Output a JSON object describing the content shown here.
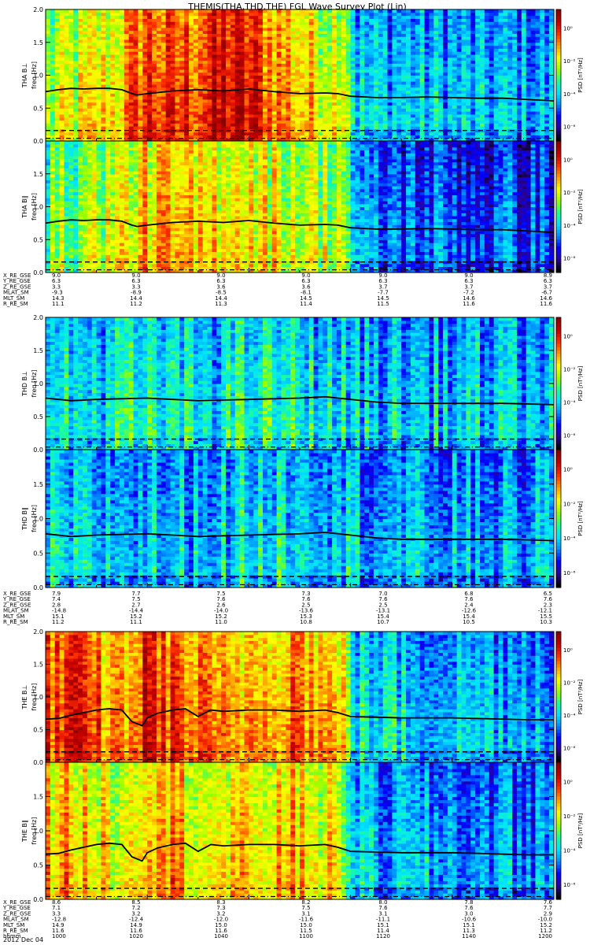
{
  "title": "THEMIS(THA,THD,THE) FGL Wave Survey Plot (Lin)",
  "date_label": "2012 Dec 04",
  "colors": {
    "colormap": [
      "#000000",
      "#2a00a0",
      "#0000ff",
      "#0090ff",
      "#00e5ff",
      "#20ff90",
      "#9aff00",
      "#ffff00",
      "#ffa000",
      "#ff3000",
      "#c80000",
      "#8a0000"
    ],
    "curve": "#000000"
  },
  "chart_data": [
    {
      "type": "heatmap",
      "ylabel": "THA B⊥",
      "yunit": "freq [Hz]",
      "ylim": [
        0,
        2.0
      ],
      "yticks": [
        "0.0",
        "0.5",
        "1.0",
        "1.5",
        "2.0"
      ],
      "colorbar": {
        "label": "PSD [nT²/Hz]",
        "ticks": [
          "10⁰",
          "10⁻²",
          "10⁻⁴",
          "10⁻⁶"
        ]
      },
      "xlim": [
        1000,
        1200
      ],
      "gyro_curve": {
        "x": [
          1000,
          1005,
          1010,
          1015,
          1020,
          1025,
          1030,
          1034,
          1036,
          1040,
          1045,
          1050,
          1060,
          1070,
          1080,
          1090,
          1100,
          1110,
          1115,
          1120,
          1130,
          1140,
          1150,
          1160,
          1170,
          1180,
          1190,
          1200
        ],
        "y": [
          0.75,
          0.78,
          0.8,
          0.79,
          0.8,
          0.8,
          0.78,
          0.72,
          0.7,
          0.72,
          0.74,
          0.76,
          0.78,
          0.76,
          0.79,
          0.75,
          0.72,
          0.73,
          0.72,
          0.68,
          0.66,
          0.66,
          0.67,
          0.66,
          0.65,
          0.65,
          0.63,
          0.61
        ]
      },
      "dashed_line_y": 0.16,
      "dashdot_line_y": 0.04,
      "activity": {
        "x": [
          1000,
          1010,
          1020,
          1030,
          1040,
          1050,
          1060,
          1070,
          1080,
          1090,
          1100,
          1110,
          1118,
          1122,
          1130,
          1140,
          1150,
          1160,
          1170,
          1180,
          1190,
          1200
        ],
        "level": [
          0.55,
          0.62,
          0.65,
          0.72,
          0.88,
          0.82,
          0.86,
          0.92,
          0.9,
          0.8,
          0.72,
          0.66,
          0.7,
          0.38,
          0.36,
          0.37,
          0.36,
          0.35,
          0.34,
          0.34,
          0.34,
          0.33
        ]
      }
    },
    {
      "type": "heatmap",
      "ylabel": "THA B∥",
      "yunit": "freq [Hz]",
      "ylim": [
        0,
        2.0
      ],
      "yticks": [
        "0.0",
        "0.5",
        "1.0",
        "1.5",
        "2.0"
      ],
      "colorbar": {
        "label": "PSD [nT²/Hz]",
        "ticks": [
          "10⁰",
          "10⁻²",
          "10⁻⁴",
          "10⁻⁶"
        ]
      },
      "xlim": [
        1000,
        1200
      ],
      "gyro_curve": {
        "x": [
          1000,
          1005,
          1010,
          1015,
          1020,
          1025,
          1030,
          1034,
          1036,
          1040,
          1045,
          1050,
          1060,
          1070,
          1080,
          1090,
          1100,
          1110,
          1115,
          1120,
          1130,
          1140,
          1150,
          1160,
          1170,
          1180,
          1190,
          1200
        ],
        "y": [
          0.75,
          0.78,
          0.8,
          0.79,
          0.8,
          0.8,
          0.78,
          0.72,
          0.7,
          0.72,
          0.74,
          0.76,
          0.78,
          0.76,
          0.79,
          0.75,
          0.72,
          0.73,
          0.72,
          0.68,
          0.66,
          0.66,
          0.67,
          0.66,
          0.65,
          0.65,
          0.63,
          0.61
        ]
      },
      "dashed_line_y": 0.16,
      "dashdot_line_y": 0.04,
      "activity": {
        "x": [
          1000,
          1010,
          1020,
          1030,
          1040,
          1050,
          1060,
          1070,
          1080,
          1090,
          1100,
          1110,
          1118,
          1122,
          1130,
          1140,
          1150,
          1160,
          1170,
          1180,
          1190,
          1200
        ],
        "level": [
          0.5,
          0.56,
          0.6,
          0.64,
          0.72,
          0.7,
          0.68,
          0.72,
          0.7,
          0.66,
          0.62,
          0.6,
          0.62,
          0.3,
          0.28,
          0.28,
          0.27,
          0.26,
          0.25,
          0.25,
          0.26,
          0.25
        ]
      }
    },
    {
      "type": "heatmap",
      "ylabel": "THD B⊥",
      "yunit": "freq [Hz]",
      "ylim": [
        0,
        2.0
      ],
      "yticks": [
        "0.0",
        "0.5",
        "1.0",
        "1.5",
        "2.0"
      ],
      "colorbar": {
        "label": "PSD [nT²/Hz]",
        "ticks": [
          "10⁰",
          "10⁻²",
          "10⁻⁴",
          "10⁻⁶"
        ]
      },
      "xlim": [
        1000,
        1200
      ],
      "gyro_curve": {
        "x": [
          1000,
          1010,
          1020,
          1030,
          1040,
          1050,
          1060,
          1070,
          1080,
          1090,
          1100,
          1110,
          1120,
          1130,
          1140,
          1150,
          1160,
          1170,
          1180,
          1190,
          1200
        ],
        "y": [
          0.78,
          0.74,
          0.76,
          0.77,
          0.78,
          0.76,
          0.74,
          0.75,
          0.76,
          0.77,
          0.78,
          0.8,
          0.76,
          0.72,
          0.7,
          0.7,
          0.7,
          0.7,
          0.7,
          0.69,
          0.68
        ]
      },
      "dashed_line_y": 0.16,
      "dashdot_line_y": 0.04,
      "activity": {
        "x": [
          1000,
          1010,
          1020,
          1030,
          1040,
          1050,
          1060,
          1070,
          1080,
          1090,
          1100,
          1110,
          1120,
          1130,
          1140,
          1150,
          1160,
          1170,
          1180,
          1190,
          1200
        ],
        "level": [
          0.42,
          0.4,
          0.4,
          0.44,
          0.42,
          0.4,
          0.4,
          0.42,
          0.44,
          0.44,
          0.42,
          0.4,
          0.38,
          0.36,
          0.36,
          0.36,
          0.36,
          0.36,
          0.35,
          0.35,
          0.35
        ]
      }
    },
    {
      "type": "heatmap",
      "ylabel": "THD B∥",
      "yunit": "freq [Hz]",
      "ylim": [
        0,
        2.0
      ],
      "yticks": [
        "0.0",
        "0.5",
        "1.0",
        "1.5",
        "2.0"
      ],
      "colorbar": {
        "label": "PSD [nT²/Hz]",
        "ticks": [
          "10⁰",
          "10⁻²",
          "10⁻⁴",
          "10⁻⁶"
        ]
      },
      "xlim": [
        1000,
        1200
      ],
      "gyro_curve": {
        "x": [
          1000,
          1010,
          1020,
          1030,
          1040,
          1050,
          1060,
          1070,
          1080,
          1090,
          1100,
          1110,
          1120,
          1130,
          1140,
          1150,
          1160,
          1170,
          1180,
          1190,
          1200
        ],
        "y": [
          0.78,
          0.74,
          0.76,
          0.77,
          0.78,
          0.76,
          0.74,
          0.75,
          0.76,
          0.77,
          0.78,
          0.8,
          0.76,
          0.72,
          0.7,
          0.7,
          0.7,
          0.7,
          0.7,
          0.69,
          0.68
        ]
      },
      "dashed_line_y": 0.16,
      "dashdot_line_y": 0.04,
      "activity": {
        "x": [
          1000,
          1010,
          1020,
          1030,
          1040,
          1050,
          1060,
          1070,
          1080,
          1090,
          1100,
          1110,
          1120,
          1130,
          1140,
          1150,
          1160,
          1170,
          1180,
          1190,
          1200
        ],
        "level": [
          0.38,
          0.36,
          0.36,
          0.36,
          0.36,
          0.36,
          0.37,
          0.38,
          0.4,
          0.42,
          0.42,
          0.4,
          0.38,
          0.35,
          0.34,
          0.33,
          0.33,
          0.33,
          0.33,
          0.33,
          0.33
        ]
      }
    },
    {
      "type": "heatmap",
      "ylabel": "THE B⊥",
      "yunit": "freq [Hz]",
      "ylim": [
        0,
        2.0
      ],
      "yticks": [
        "0.0",
        "0.5",
        "1.0",
        "1.5",
        "2.0"
      ],
      "colorbar": {
        "label": "PSD [nT²/Hz]",
        "ticks": [
          "10⁰",
          "10⁻²",
          "10⁻⁴",
          "10⁻⁶"
        ]
      },
      "xlim": [
        1000,
        1200
      ],
      "gyro_curve": {
        "x": [
          1000,
          1005,
          1010,
          1015,
          1020,
          1025,
          1030,
          1034,
          1038,
          1040,
          1044,
          1050,
          1055,
          1060,
          1065,
          1070,
          1080,
          1090,
          1100,
          1110,
          1115,
          1120,
          1130,
          1140,
          1150,
          1160,
          1170,
          1180,
          1190,
          1200
        ],
        "y": [
          0.66,
          0.67,
          0.72,
          0.76,
          0.8,
          0.82,
          0.8,
          0.62,
          0.56,
          0.68,
          0.75,
          0.8,
          0.82,
          0.7,
          0.8,
          0.78,
          0.8,
          0.8,
          0.78,
          0.8,
          0.76,
          0.7,
          0.69,
          0.68,
          0.68,
          0.68,
          0.67,
          0.66,
          0.65,
          0.65
        ]
      },
      "dashed_line_y": 0.16,
      "dashdot_line_y": 0.04,
      "activity": {
        "x": [
          1000,
          1010,
          1020,
          1030,
          1040,
          1050,
          1060,
          1070,
          1080,
          1090,
          1100,
          1110,
          1118,
          1122,
          1130,
          1140,
          1150,
          1160,
          1170,
          1180,
          1190,
          1200
        ],
        "level": [
          0.82,
          0.86,
          0.8,
          0.74,
          0.9,
          0.84,
          0.78,
          0.72,
          0.76,
          0.8,
          0.82,
          0.74,
          0.66,
          0.42,
          0.4,
          0.39,
          0.38,
          0.38,
          0.37,
          0.37,
          0.36,
          0.36
        ]
      }
    },
    {
      "type": "heatmap",
      "ylabel": "THE B∥",
      "yunit": "freq [Hz]",
      "ylim": [
        0,
        2.0
      ],
      "yticks": [
        "0.0",
        "0.5",
        "1.0",
        "1.5",
        "2.0"
      ],
      "colorbar": {
        "label": "PSD [nT²/Hz]",
        "ticks": [
          "10⁰",
          "10⁻²",
          "10⁻⁴",
          "10⁻⁶"
        ]
      },
      "xlim": [
        1000,
        1200
      ],
      "gyro_curve": {
        "x": [
          1000,
          1005,
          1010,
          1015,
          1020,
          1025,
          1030,
          1034,
          1038,
          1040,
          1044,
          1050,
          1055,
          1060,
          1065,
          1070,
          1080,
          1090,
          1100,
          1110,
          1115,
          1120,
          1130,
          1140,
          1150,
          1160,
          1170,
          1180,
          1190,
          1200
        ],
        "y": [
          0.66,
          0.67,
          0.72,
          0.76,
          0.8,
          0.82,
          0.8,
          0.62,
          0.56,
          0.68,
          0.75,
          0.8,
          0.82,
          0.7,
          0.8,
          0.78,
          0.8,
          0.8,
          0.78,
          0.8,
          0.76,
          0.7,
          0.69,
          0.68,
          0.68,
          0.68,
          0.67,
          0.66,
          0.65,
          0.65
        ]
      },
      "dashed_line_y": 0.16,
      "dashdot_line_y": 0.04,
      "activity": {
        "x": [
          1000,
          1010,
          1020,
          1030,
          1040,
          1050,
          1060,
          1070,
          1080,
          1090,
          1100,
          1110,
          1118,
          1122,
          1130,
          1140,
          1150,
          1160,
          1170,
          1180,
          1190,
          1200
        ],
        "level": [
          0.72,
          0.74,
          0.7,
          0.66,
          0.8,
          0.76,
          0.7,
          0.66,
          0.68,
          0.7,
          0.72,
          0.66,
          0.6,
          0.36,
          0.34,
          0.33,
          0.32,
          0.32,
          0.31,
          0.31,
          0.31,
          0.31
        ]
      }
    }
  ],
  "ephemeris": [
    {
      "rows": [
        {
          "label": "X_RE_GSE",
          "values": [
            "9.0",
            "9.0",
            "9.0",
            "9.0",
            "9.0",
            "9.0",
            "8.9"
          ]
        },
        {
          "label": "Y_RE_GSE",
          "values": [
            "6.3",
            "6.3",
            "6.3",
            "6.3",
            "6.3",
            "6.3",
            "6.3"
          ]
        },
        {
          "label": "Z_RE_GSE",
          "values": [
            "3.3",
            "3.3",
            "3.6",
            "3.6",
            "3.7",
            "3.7",
            "3.7"
          ]
        },
        {
          "label": "MLAT_SM",
          "values": [
            "-9.3",
            "-8.9",
            "-8.5",
            "-8.1",
            "-7.7",
            "-7.2",
            "-6.7"
          ]
        },
        {
          "label": "MLT_SM",
          "values": [
            "14.3",
            "14.4",
            "14.4",
            "14.5",
            "14.5",
            "14.6",
            "14.6"
          ]
        },
        {
          "label": "R_RE_SM",
          "values": [
            "11.1",
            "11.2",
            "11.3",
            "11.4",
            "11.5",
            "11.6",
            "11.6"
          ]
        }
      ]
    },
    {
      "rows": [
        {
          "label": "X_RE_GSE",
          "values": [
            "7.9",
            "7.7",
            "7.5",
            "7.3",
            "7.0",
            "6.8",
            "6.5"
          ]
        },
        {
          "label": "Y_RE_GSE",
          "values": [
            "7.4",
            "7.5",
            "7.6",
            "7.6",
            "7.6",
            "7.6",
            "7.6"
          ]
        },
        {
          "label": "Z_RE_GSE",
          "values": [
            "2.8",
            "2.7",
            "2.6",
            "2.5",
            "2.5",
            "2.4",
            "2.3"
          ]
        },
        {
          "label": "MLAT_SM",
          "values": [
            "-14.8",
            "-14.4",
            "-14.0",
            "-13.6",
            "-13.1",
            "-12.6",
            "-12.1"
          ]
        },
        {
          "label": "MLT_SM",
          "values": [
            "15.1",
            "15.2",
            "15.2",
            "15.3",
            "15.4",
            "15.4",
            "15.5"
          ]
        },
        {
          "label": "R_RE_SM",
          "values": [
            "11.2",
            "11.1",
            "11.0",
            "10.8",
            "10.7",
            "10.5",
            "10.3"
          ]
        }
      ]
    },
    {
      "rows": [
        {
          "label": "X_RE_GSE",
          "values": [
            "8.6",
            "8.5",
            "8.3",
            "8.2",
            "8.0",
            "7.8",
            "7.6"
          ]
        },
        {
          "label": "Y_RE_GSE",
          "values": [
            "7.1",
            "7.2",
            "7.3",
            "7.5",
            "7.6",
            "7.6",
            "7.7"
          ]
        },
        {
          "label": "Z_RE_GSE",
          "values": [
            "3.3",
            "3.2",
            "3.2",
            "3.1",
            "3.1",
            "3.0",
            "2.9"
          ]
        },
        {
          "label": "MLAT_SM",
          "values": [
            "-12.8",
            "-12.4",
            "-12.0",
            "-11.6",
            "-11.1",
            "-10.6",
            "-10.0"
          ]
        },
        {
          "label": "MLT_SM",
          "values": [
            "14.9",
            "14.9",
            "15.0",
            "15.0",
            "15.1",
            "15.1",
            "15.2"
          ]
        },
        {
          "label": "R_RE_SM",
          "values": [
            "11.6",
            "11.6",
            "11.6",
            "11.5",
            "11.4",
            "11.3",
            "11.2"
          ]
        },
        {
          "label": "hhmm",
          "values": [
            "1000",
            "1020",
            "1040",
            "1100",
            "1120",
            "1140",
            "1200"
          ]
        }
      ]
    }
  ]
}
